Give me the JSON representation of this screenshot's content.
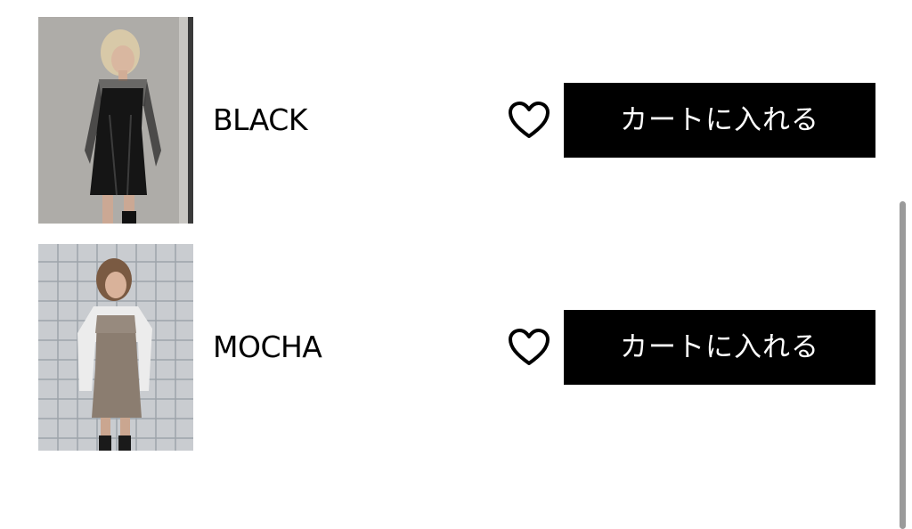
{
  "variants": [
    {
      "color": "BLACK",
      "cart_label": "カートに入れる",
      "favorite_icon": "heart-outline-icon",
      "image_alt": "black-dress-photo"
    },
    {
      "color": "MOCHA",
      "cart_label": "カートに入れる",
      "favorite_icon": "heart-outline-icon",
      "image_alt": "mocha-dress-photo"
    }
  ],
  "colors": {
    "button_bg": "#000000",
    "button_text": "#ffffff",
    "scrollbar": "#9a9a9a"
  }
}
